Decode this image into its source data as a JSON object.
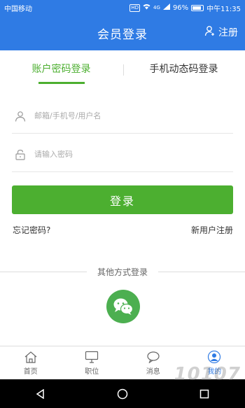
{
  "status_bar": {
    "carrier": "中国移动",
    "hd": "HD",
    "signal": "4G",
    "battery": "96%",
    "time": "中午11:35"
  },
  "header": {
    "title": "会员登录",
    "register": "注册"
  },
  "tabs": [
    {
      "label": "账户密码登录",
      "active": true
    },
    {
      "label": "手机动态码登录",
      "active": false
    }
  ],
  "form": {
    "username_placeholder": "邮箱/手机号/用户名",
    "password_placeholder": "请输入密码",
    "login_button": "登录",
    "forgot_password": "忘记密码?",
    "new_user_register": "新用户注册"
  },
  "other_login": {
    "label": "其他方式登录",
    "icon": "wechat-icon"
  },
  "bottom_nav": [
    {
      "label": "首页",
      "icon": "home-icon"
    },
    {
      "label": "职位",
      "icon": "monitor-icon"
    },
    {
      "label": "消息",
      "icon": "chat-bubble-icon"
    },
    {
      "label": "我的",
      "icon": "user-icon",
      "active": true
    }
  ],
  "watermark": "10107",
  "colors": {
    "header": "#2f7be4",
    "accent": "#4caf30"
  }
}
